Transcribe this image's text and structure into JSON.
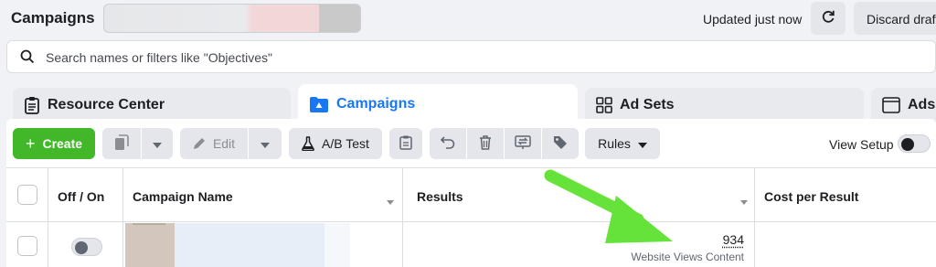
{
  "header": {
    "title": "Campaigns",
    "status": "Updated just now",
    "refresh_icon": "refresh-icon",
    "discard_label": "Discard drafts"
  },
  "search": {
    "placeholder": "Search names or filters like \"Objectives\"",
    "value": ""
  },
  "tabs": [
    {
      "label": "Resource Center",
      "icon": "clipboard-icon",
      "active": false
    },
    {
      "label": "Campaigns",
      "icon": "folder-icon",
      "active": true
    },
    {
      "label": "Ad Sets",
      "icon": "grid-icon",
      "active": false
    },
    {
      "label": "Ads",
      "icon": "window-icon",
      "active": false
    }
  ],
  "toolbar": {
    "create_label": "Create",
    "edit_label": "Edit",
    "ab_test_label": "A/B Test",
    "rules_label": "Rules",
    "view_setup_label": "View Setup",
    "view_setup_on": false
  },
  "table": {
    "columns": [
      "Off / On",
      "Campaign Name",
      "Results",
      "Cost per Result"
    ],
    "rows": [
      {
        "on": false,
        "campaign_name": "",
        "results_value": "934",
        "results_label": "Website Views Content",
        "cost_per_result": ""
      }
    ]
  },
  "colors": {
    "accent": "#1877f2",
    "create_button": "#42b72a",
    "annotation_arrow": "#66e33a"
  }
}
